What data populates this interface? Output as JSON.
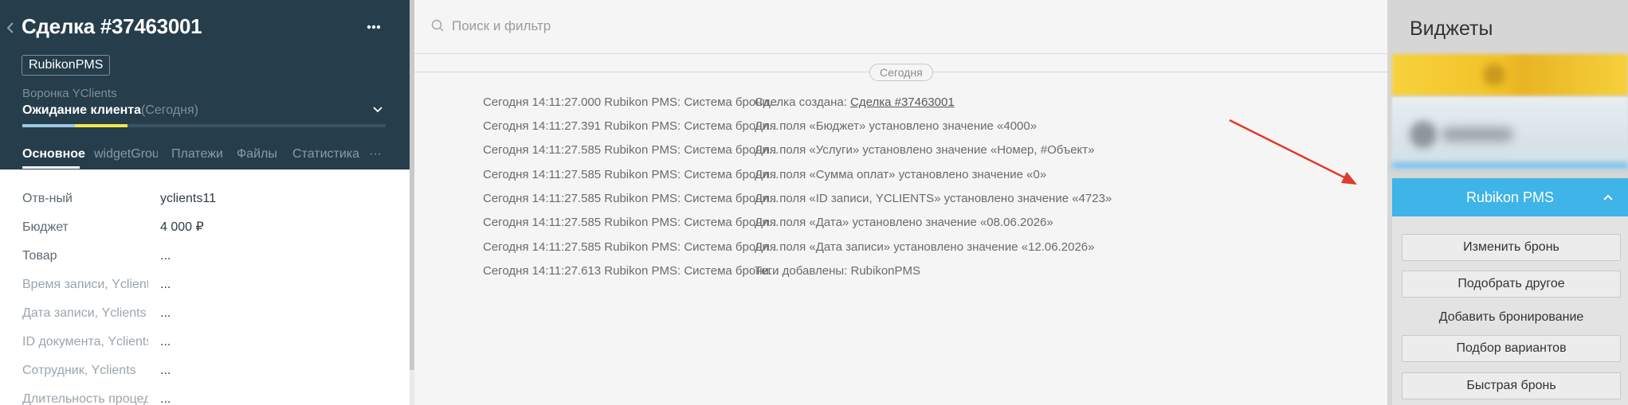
{
  "deal": {
    "title": "Сделка #37463001",
    "tag": "RubikonPMS",
    "pipeline": "Воронка YClients",
    "status": "Ожидание клиента",
    "status_date": "(Сегодня)",
    "progress_colors": [
      "#9cc7e4",
      "#f7e64b",
      "#3b5261"
    ]
  },
  "tabs": [
    {
      "label": "Основное",
      "active": true
    },
    {
      "label": "widgetGroup",
      "active": false
    },
    {
      "label": "Платежи",
      "active": false
    },
    {
      "label": "Файлы",
      "active": false
    },
    {
      "label": "Статистика",
      "active": false
    },
    {
      "label": "···",
      "active": false
    }
  ],
  "fields": [
    {
      "label": "Отв-ный",
      "value": "yclients11"
    },
    {
      "label": "Бюджет",
      "value": "4 000  ₽"
    },
    {
      "label": "Товар",
      "value": "..."
    },
    {
      "label": "Время записи, Yclients",
      "value": "..."
    },
    {
      "label": "Дата записи, Yclients",
      "value": "..."
    },
    {
      "label": "ID документа, Yclients",
      "value": "..."
    },
    {
      "label": "Сотрудник, Yclients",
      "value": "..."
    },
    {
      "label": "Длительность процедуры",
      "value": "..."
    }
  ],
  "search": {
    "placeholder": "Поиск и фильтр"
  },
  "feed": {
    "day_label": "Сегодня",
    "events": [
      {
        "time": "Сегодня 14:11:27.000 Rubikon PMS: Система брони...",
        "text": "Сделка создана: ",
        "link": "Сделка #37463001"
      },
      {
        "time": "Сегодня 14:11:27.391 Rubikon PMS: Система брони...",
        "text": "Для поля «Бюджет» установлено значение «4000»",
        "link": ""
      },
      {
        "time": "Сегодня 14:11:27.585 Rubikon PMS: Система брони...",
        "text": "Для поля «Услуги» установлено значение «Номер, #Объект»",
        "link": ""
      },
      {
        "time": "Сегодня 14:11:27.585 Rubikon PMS: Система брони...",
        "text": "Для поля «Сумма оплат» установлено значение «0»",
        "link": ""
      },
      {
        "time": "Сегодня 14:11:27.585 Rubikon PMS: Система брони...",
        "text": "Для поля «ID записи, YCLIENTS» установлено значение «4723»",
        "link": ""
      },
      {
        "time": "Сегодня 14:11:27.585 Rubikon PMS: Система брони...",
        "text": "Для поля «Дата» установлено значение «08.06.2026»",
        "link": ""
      },
      {
        "time": "Сегодня 14:11:27.585 Rubikon PMS: Система брони...",
        "text": "Для поля «Дата записи» установлено значение «12.06.2026»",
        "link": ""
      },
      {
        "time": "Сегодня 14:11:27.613 Rubikon PMS: Система брони...",
        "text": "Теги добавлены: RubikonPMS",
        "link": ""
      }
    ]
  },
  "widgets": {
    "title": "Виджеты",
    "rubikon": {
      "title": "Rubikon PMS",
      "buttons": [
        "Изменить бронь",
        "Подобрать другое",
        "Добавить бронирование",
        "Подбор вариантов",
        "Быстрая бронь"
      ]
    }
  },
  "colors": {
    "sidebar_bg": "#263d4b",
    "accent_blue": "#3fb4e8",
    "arrow_red": "#e2392d"
  }
}
